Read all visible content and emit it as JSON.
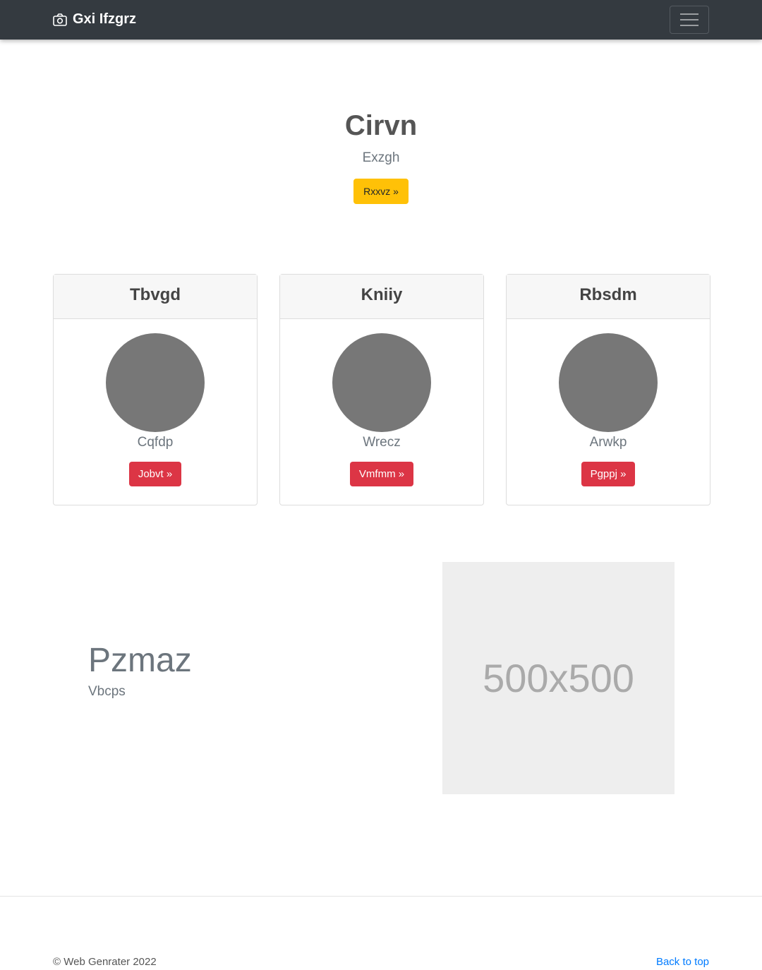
{
  "navbar": {
    "brand": "Gxi Ifzgrz",
    "brand_icon": "camera-icon",
    "toggler_icon": "hamburger-icon"
  },
  "hero": {
    "title": "Cirvn",
    "subtitle": "Exzgh",
    "button": "Rxxvz »",
    "button_color": "#ffc107"
  },
  "cards": [
    {
      "title": "Tbvgd",
      "text": "Cqfdp",
      "button": "Jobvt »"
    },
    {
      "title": "Kniiy",
      "text": "Wrecz",
      "button": "Vmfmm »"
    },
    {
      "title": "Rbsdm",
      "text": "Arwkp",
      "button": "Pgppj »"
    }
  ],
  "feature": {
    "title": "Pzmaz",
    "subtitle": "Vbcps",
    "image_label": "500x500"
  },
  "footer": {
    "copyright": "© Web Genrater 2022",
    "back_to_top": "Back to top"
  },
  "colors": {
    "navbar": "#343a40",
    "danger": "#dc3545",
    "link": "#007bff"
  }
}
